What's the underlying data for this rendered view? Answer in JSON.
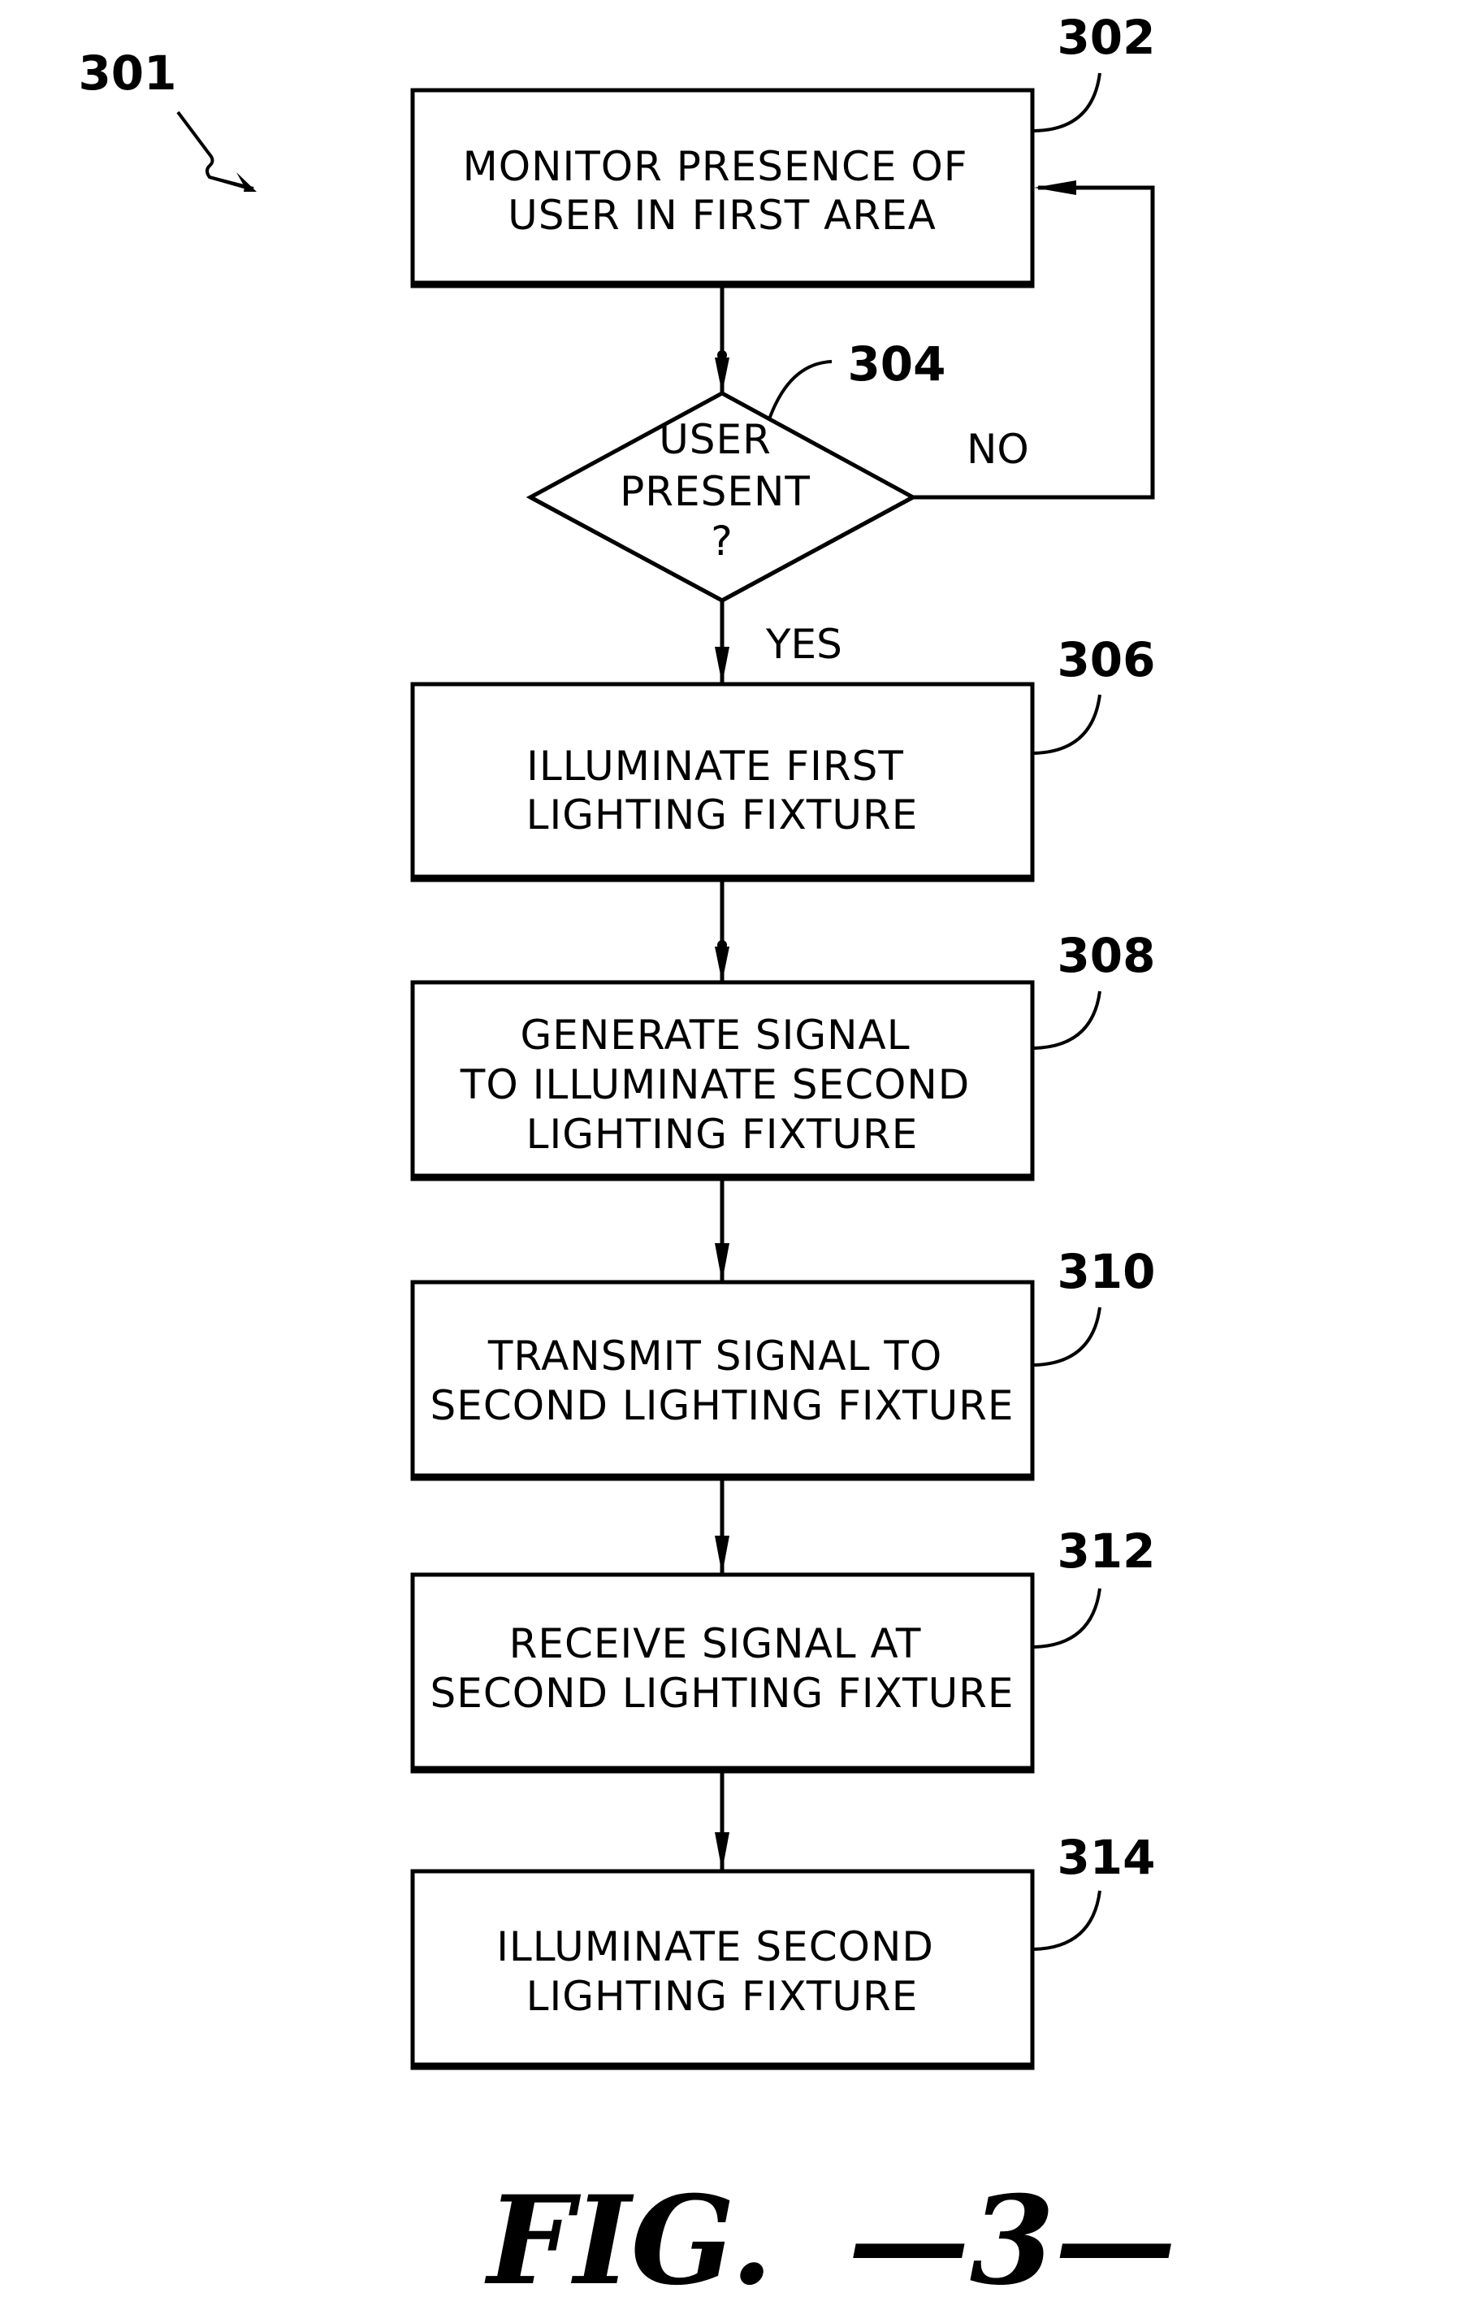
{
  "figure": {
    "label": "FIG.",
    "number": "—3—",
    "reference": "301"
  },
  "steps": [
    {
      "id": "302",
      "type": "process",
      "lines": [
        "MONITOR PRESENCE OF",
        "USER IN FIRST AREA"
      ]
    },
    {
      "id": "304",
      "type": "decision",
      "lines": [
        "USER",
        "PRESENT",
        "?"
      ]
    },
    {
      "id": "306",
      "type": "process",
      "lines": [
        "ILLUMINATE FIRST",
        "LIGHTING FIXTURE"
      ]
    },
    {
      "id": "308",
      "type": "process",
      "lines": [
        "GENERATE SIGNAL",
        "TO ILLUMINATE SECOND",
        "LIGHTING FIXTURE"
      ]
    },
    {
      "id": "310",
      "type": "process",
      "lines": [
        "TRANSMIT SIGNAL TO",
        "SECOND LIGHTING FIXTURE"
      ]
    },
    {
      "id": "312",
      "type": "process",
      "lines": [
        "RECEIVE SIGNAL AT",
        "SECOND LIGHTING FIXTURE"
      ]
    },
    {
      "id": "314",
      "type": "process",
      "lines": [
        "ILLUMINATE SECOND",
        "LIGHTING FIXTURE"
      ]
    }
  ],
  "branches": {
    "no": "NO",
    "yes": "YES"
  },
  "colors": {
    "ink": "#000000",
    "paper": "#ffffff"
  }
}
